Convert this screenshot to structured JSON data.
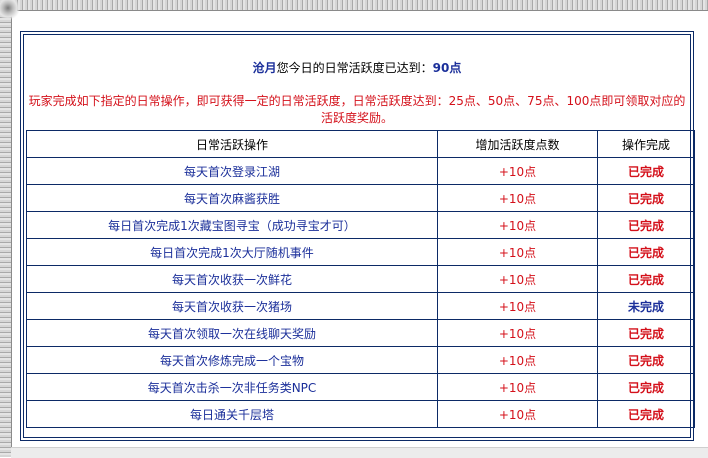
{
  "summary": {
    "user": "沧月",
    "text": "您今日的日常活跃度已达到：",
    "points": "90点"
  },
  "description": "玩家完成如下指定的日常操作，即可获得一定的日常活跃度，日常活跃度达到：25点、50点、75点、100点即可领取对应的活跃度奖励。",
  "table": {
    "headers": [
      "日常活跃操作",
      "增加活跃度点数",
      "操作完成"
    ],
    "rows": [
      {
        "task": "每天首次登录江湖",
        "points": "+10点",
        "status": "已完成"
      },
      {
        "task": "每天首次麻酱获胜",
        "points": "+10点",
        "status": "已完成"
      },
      {
        "task": "每日首次完成1次藏宝图寻宝（成功寻宝才可）",
        "points": "+10点",
        "status": "已完成"
      },
      {
        "task": "每日首次完成1次大厅随机事件",
        "points": "+10点",
        "status": "已完成"
      },
      {
        "task": "每天首次收获一次鲜花",
        "points": "+10点",
        "status": "已完成"
      },
      {
        "task": "每天首次收获一次猪场",
        "points": "+10点",
        "status": "未完成"
      },
      {
        "task": "每天首次领取一次在线聊天奖励",
        "points": "+10点",
        "status": "已完成"
      },
      {
        "task": "每天首次修炼完成一个宝物",
        "points": "+10点",
        "status": "已完成"
      },
      {
        "task": "每天首次击杀一次非任务类NPC",
        "points": "+10点",
        "status": "已完成"
      },
      {
        "task": "每日通关千层塔",
        "points": "+10点",
        "status": "已完成"
      }
    ]
  },
  "colors": {
    "border": "#0c2a66",
    "task_text": "#1b2f9a",
    "highlight_red": "#d4101a",
    "pending_blue": "#1b2f9a"
  }
}
